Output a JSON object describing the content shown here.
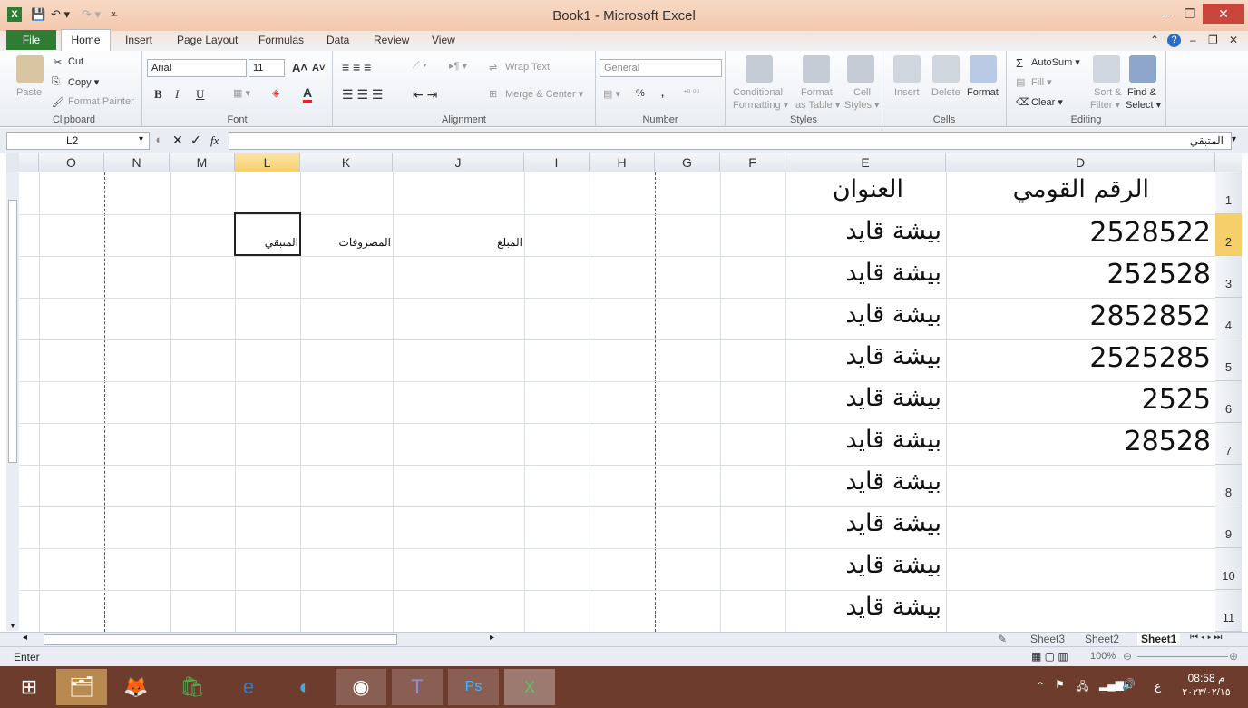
{
  "window": {
    "title": "Book1 - Microsoft Excel"
  },
  "tabs": {
    "file": "File",
    "home": "Home",
    "insert": "Insert",
    "page_layout": "Page Layout",
    "formulas": "Formulas",
    "data": "Data",
    "review": "Review",
    "view": "View"
  },
  "ribbon": {
    "clipboard": {
      "paste": "Paste",
      "cut": "Cut",
      "copy": "Copy ▾",
      "format_painter": "Format Painter",
      "label": "Clipboard"
    },
    "font": {
      "name": "Arial",
      "size": "11",
      "label": "Font",
      "bold": "B",
      "italic": "I",
      "underline": "U"
    },
    "alignment": {
      "wrap_text": "Wrap Text",
      "merge_center": "Merge & Center ▾",
      "label": "Alignment"
    },
    "number": {
      "format": "General",
      "percent": "%",
      "comma": ",",
      "label": "Number"
    },
    "styles": {
      "conditional": "Conditional",
      "formatting": "Formatting ▾",
      "format_as": "Format",
      "as_table": "as Table ▾",
      "cell": "Cell",
      "cell_styles": "Styles ▾",
      "label": "Styles"
    },
    "cells": {
      "insert": "Insert",
      "delete": "Delete",
      "format": "Format",
      "label": "Cells"
    },
    "editing": {
      "autosum": "AutoSum ▾",
      "fill": "Fill ▾",
      "clear": "Clear ▾",
      "sort": "Sort &",
      "filter": "Filter ▾",
      "find": "Find &",
      "select": "Select ▾",
      "label": "Editing"
    }
  },
  "formula_bar": {
    "name_box": "L2",
    "fx": "fx",
    "content": "المتبقي"
  },
  "columns": [
    "O",
    "N",
    "M",
    "L",
    "K",
    "J",
    "I",
    "H",
    "G",
    "F",
    "E",
    "D"
  ],
  "selected_column": "L",
  "rows": [
    "1",
    "2",
    "3",
    "4",
    "5",
    "6",
    "7",
    "8",
    "9",
    "10",
    "11"
  ],
  "selected_row": "2",
  "cells": {
    "D1": "الرقم القومي",
    "E1": "العنوان",
    "D2": "2528522",
    "D3": "252528",
    "D4": "2852852",
    "D5": "2525285",
    "D6": "2525",
    "D7": "28528",
    "E2": "بيشة قايد",
    "E3": "بيشة قايد",
    "E4": "بيشة قايد",
    "E5": "بيشة قايد",
    "E6": "بيشة قايد",
    "E7": "بيشة قايد",
    "E8": "بيشة قايد",
    "E9": "بيشة قايد",
    "E10": "بيشة قايد",
    "E11": "بيشة قايد",
    "J2": "المبلغ",
    "K2": "المصروفات",
    "L2": "المتبقي"
  },
  "sheets": [
    "Sheet3",
    "Sheet2",
    "Sheet1"
  ],
  "active_sheet": "Sheet1",
  "status": {
    "mode": "Enter",
    "zoom": "100%"
  },
  "taskbar": {
    "time": "08:58 م",
    "date": "٢٠٢٣/٠٢/١٥",
    "lang": "ع"
  }
}
